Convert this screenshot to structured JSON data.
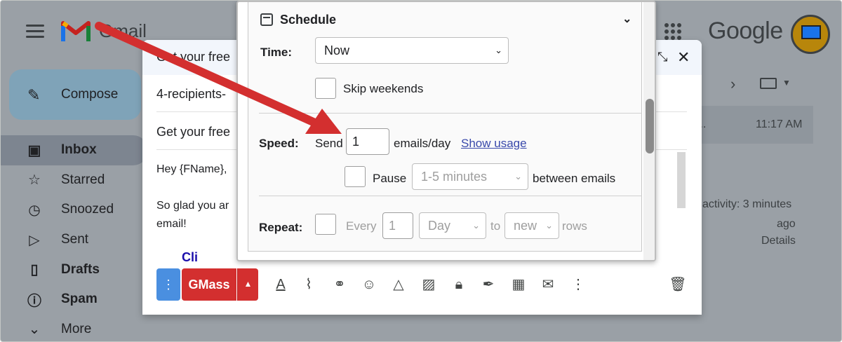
{
  "gmail": {
    "logo_text": "Gmail",
    "google_logo": "Google",
    "compose_label": "Compose",
    "nav": [
      {
        "label": "Inbox",
        "icon": "inbox-icon"
      },
      {
        "label": "Starred",
        "icon": "star-icon"
      },
      {
        "label": "Snoozed",
        "icon": "clock-icon"
      },
      {
        "label": "Sent",
        "icon": "send-icon"
      },
      {
        "label": "Drafts",
        "icon": "draft-icon"
      },
      {
        "label": "Spam",
        "icon": "spam-icon"
      },
      {
        "label": "More",
        "icon": "chevron-down-icon"
      }
    ],
    "list": {
      "row_snippet": "...",
      "row_time": "11:17 AM",
      "activity": "activity: 3 minutes",
      "ago": "ago",
      "details": "Details"
    }
  },
  "compose": {
    "title": "Get your free",
    "recipients": "4-recipients-",
    "subject": "Get your free",
    "body_line1": "Hey {FName},",
    "body_line2": "So glad you ar",
    "body_line3": "email!",
    "link_fragment": "Cli",
    "more_button": "⋮",
    "gmass_button": "GMass"
  },
  "schedule_panel": {
    "title": "Schedule",
    "time_label": "Time:",
    "time_value": "Now",
    "skip_weekends_label": "Skip weekends",
    "speed_label": "Speed:",
    "send_label": "Send",
    "send_value": "1",
    "emails_per_day": "emails/day",
    "show_usage": "Show usage",
    "pause_label": "Pause",
    "pause_value": "1-5 minutes",
    "between_emails": "between emails",
    "repeat_label": "Repeat:",
    "every_label": "Every",
    "every_value": "1",
    "every_unit": "Day",
    "to_label": "to",
    "to_value": "new",
    "rows_label": "rows"
  },
  "colors": {
    "arrow": "#d32f2f",
    "gmass_red": "#d32f2f",
    "link_blue": "#3949ab"
  }
}
